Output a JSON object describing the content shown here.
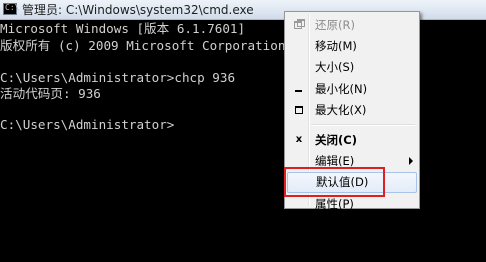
{
  "window": {
    "title": "管理员: C:\\Windows\\system32\\cmd.exe",
    "icon_prompt": "C:\\"
  },
  "console": {
    "lines": [
      "Microsoft Windows [版本 6.1.7601]",
      "版权所有 (c) 2009 Microsoft Corporation。保留所有权利。",
      "",
      "C:\\Users\\Administrator>chcp 936",
      "活动代码页: 936",
      "",
      "C:\\Users\\Administrator>"
    ]
  },
  "context_menu": {
    "items": [
      {
        "label": "还原(R)",
        "icon": "restore-icon",
        "state": "disabled"
      },
      {
        "label": "移动(M)",
        "icon": "",
        "state": "normal"
      },
      {
        "label": "大小(S)",
        "icon": "",
        "state": "normal"
      },
      {
        "label": "最小化(N)",
        "icon": "minimize-icon",
        "state": "normal"
      },
      {
        "label": "最大化(X)",
        "icon": "maximize-icon",
        "state": "normal"
      },
      {
        "label": "关闭(C)",
        "icon": "close-icon",
        "icon_char": "x",
        "state": "bold"
      },
      {
        "label": "编辑(E)",
        "icon": "",
        "state": "normal",
        "submenu": true
      },
      {
        "label": "默认值(D)",
        "icon": "",
        "state": "highlighted"
      },
      {
        "label": "属性(P)",
        "icon": "",
        "state": "normal"
      }
    ]
  },
  "colors": {
    "console_bg": "#000000",
    "console_text": "#d0d0d0",
    "menu_bg": "#f1f1f1",
    "highlight_border": "#a8c3e8",
    "annotation_box": "#e02020"
  }
}
